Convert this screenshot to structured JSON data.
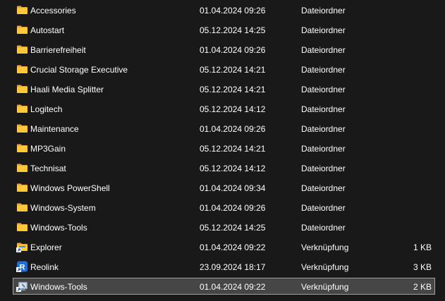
{
  "files": [
    {
      "name": "Accessories",
      "date": "01.04.2024 09:26",
      "type": "Dateiordner",
      "size": "",
      "icon": "folder-icon"
    },
    {
      "name": "Autostart",
      "date": "05.12.2024 14:25",
      "type": "Dateiordner",
      "size": "",
      "icon": "folder-icon"
    },
    {
      "name": "Barrierefreiheit",
      "date": "01.04.2024 09:26",
      "type": "Dateiordner",
      "size": "",
      "icon": "folder-icon"
    },
    {
      "name": "Crucial Storage Executive",
      "date": "05.12.2024 14:21",
      "type": "Dateiordner",
      "size": "",
      "icon": "folder-icon"
    },
    {
      "name": "Haali Media Splitter",
      "date": "05.12.2024 14:21",
      "type": "Dateiordner",
      "size": "",
      "icon": "folder-icon"
    },
    {
      "name": "Logitech",
      "date": "05.12.2024 14:12",
      "type": "Dateiordner",
      "size": "",
      "icon": "folder-icon"
    },
    {
      "name": "Maintenance",
      "date": "01.04.2024 09:26",
      "type": "Dateiordner",
      "size": "",
      "icon": "folder-icon"
    },
    {
      "name": "MP3Gain",
      "date": "05.12.2024 14:21",
      "type": "Dateiordner",
      "size": "",
      "icon": "folder-icon"
    },
    {
      "name": "Technisat",
      "date": "05.12.2024 14:12",
      "type": "Dateiordner",
      "size": "",
      "icon": "folder-icon"
    },
    {
      "name": "Windows PowerShell",
      "date": "01.04.2024 09:34",
      "type": "Dateiordner",
      "size": "",
      "icon": "folder-icon"
    },
    {
      "name": "Windows-System",
      "date": "01.04.2024 09:26",
      "type": "Dateiordner",
      "size": "",
      "icon": "folder-icon"
    },
    {
      "name": "Windows-Tools",
      "date": "05.12.2024 14:25",
      "type": "Dateiordner",
      "size": "",
      "icon": "folder-icon"
    },
    {
      "name": "Explorer",
      "date": "01.04.2024 09:22",
      "type": "Verknüpfung",
      "size": "1 KB",
      "icon": "explorer-shortcut-icon"
    },
    {
      "name": "Reolink",
      "date": "23.09.2024 18:17",
      "type": "Verknüpfung",
      "size": "3 KB",
      "icon": "reolink-shortcut-icon"
    },
    {
      "name": "Windows-Tools",
      "date": "01.04.2024 09:22",
      "type": "Verknüpfung",
      "size": "2 KB",
      "icon": "windows-tools-shortcut-icon",
      "selected": true
    }
  ],
  "colors": {
    "background": "#191919",
    "text": "#ffffff",
    "folder": "#ffc83d",
    "selection_background": "#464646",
    "selection_border": "#a0a0a0"
  }
}
